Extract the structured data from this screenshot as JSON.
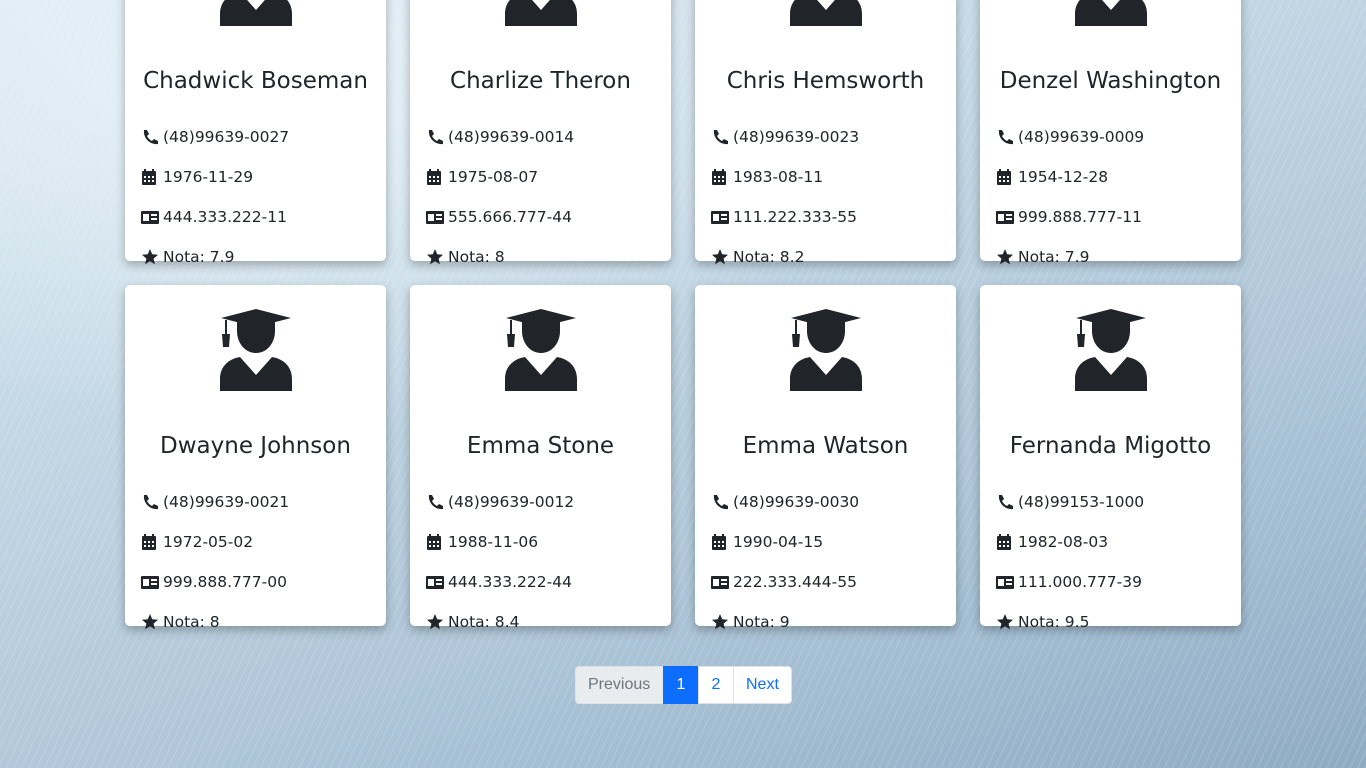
{
  "students": [
    {
      "name": "Chadwick Boseman",
      "phone": "(48)99639-0027",
      "birth": "1976-11-29",
      "doc": "444.333.222-11",
      "grade": "Nota: 7.9"
    },
    {
      "name": "Charlize Theron",
      "phone": "(48)99639-0014",
      "birth": "1975-08-07",
      "doc": "555.666.777-44",
      "grade": "Nota: 8"
    },
    {
      "name": "Chris Hemsworth",
      "phone": "(48)99639-0023",
      "birth": "1983-08-11",
      "doc": "111.222.333-55",
      "grade": "Nota: 8.2"
    },
    {
      "name": "Denzel Washington",
      "phone": "(48)99639-0009",
      "birth": "1954-12-28",
      "doc": "999.888.777-11",
      "grade": "Nota: 7.9"
    },
    {
      "name": "Dwayne Johnson",
      "phone": "(48)99639-0021",
      "birth": "1972-05-02",
      "doc": "999.888.777-00",
      "grade": "Nota: 8"
    },
    {
      "name": "Emma Stone",
      "phone": "(48)99639-0012",
      "birth": "1988-11-06",
      "doc": "444.333.222-44",
      "grade": "Nota: 8.4"
    },
    {
      "name": "Emma Watson",
      "phone": "(48)99639-0030",
      "birth": "1990-04-15",
      "doc": "222.333.444-55",
      "grade": "Nota: 9"
    },
    {
      "name": "Fernanda Migotto",
      "phone": "(48)99153-1000",
      "birth": "1982-08-03",
      "doc": "111.000.777-39",
      "grade": "Nota: 9.5"
    }
  ],
  "icons": {
    "avatar": "graduate-icon",
    "phone": "phone-icon",
    "birth": "calendar-icon",
    "doc": "id-card-icon",
    "grade": "star-icon"
  },
  "pagination": {
    "previous": "Previous",
    "pages": [
      "1",
      "2"
    ],
    "active_page": "1",
    "next": "Next"
  },
  "colors": {
    "accent": "#0d6efd",
    "icon": "#212529",
    "card": "#ffffff"
  }
}
